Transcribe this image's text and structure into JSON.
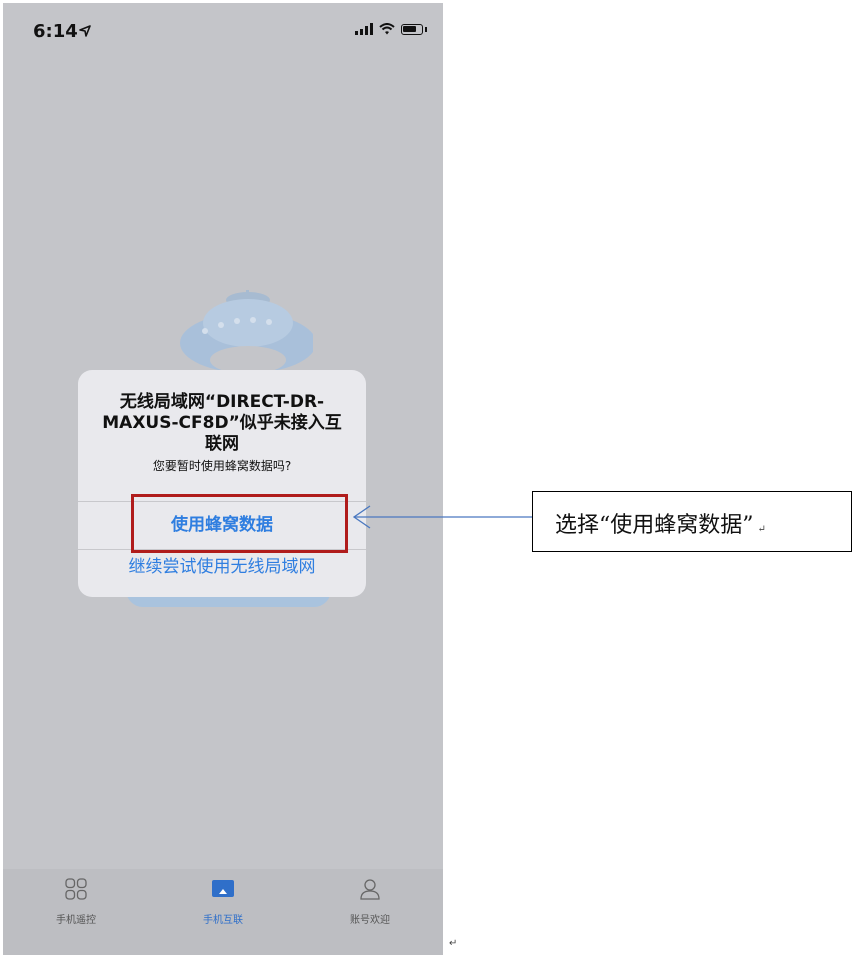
{
  "status_bar": {
    "time": "6:14"
  },
  "dialog": {
    "title_line1": "无线局域网“DIRECT-DR-",
    "title_line2": "MAXUS-CF8D”似乎未接入互",
    "title_line3": "联网",
    "message": "您要暂时使用蜂窝数据吗?",
    "primary_button": "使用蜂窝数据",
    "secondary_button": "继续尝试使用无线局域网"
  },
  "tabbar": {
    "items": [
      {
        "label": "手机遥控",
        "icon": "grid-icon"
      },
      {
        "label": "手机互联",
        "icon": "screen-cast-icon"
      },
      {
        "label": "账号欢迎",
        "icon": "person-icon"
      }
    ],
    "active_index": 1
  },
  "callout": {
    "text": "选择“使用蜂窝数据”",
    "mark": "↵"
  },
  "page_mark": "↵",
  "colors": {
    "accent": "#2f7ee0",
    "highlight": "#b01c1c",
    "arrow": "#4a78c0",
    "screen_dim": "#c4c5c9"
  }
}
